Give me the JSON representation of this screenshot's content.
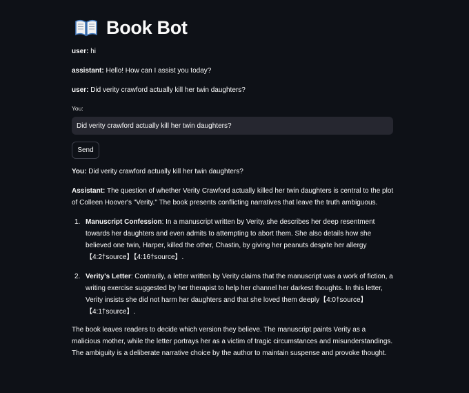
{
  "app": {
    "title": "Book Bot",
    "title_icon": "open-book-icon"
  },
  "history": [
    {
      "role": "user:",
      "text": " hi"
    },
    {
      "role": "assistant:",
      "text": " Hello! How can I assist you today?"
    },
    {
      "role": "user:",
      "text": " Did verity crawford actually kill her twin daughters?"
    }
  ],
  "input": {
    "label": "You:",
    "value": "Did verity crawford actually kill her twin daughters?"
  },
  "send_button": {
    "label": "Send"
  },
  "response": {
    "you_label": "You:",
    "you_text": " Did verity crawford actually kill her twin daughters?",
    "assistant_label": "Assistant:",
    "intro": " The question of whether Verity Crawford actually killed her twin daughters is central to the plot of Colleen Hoover's \"Verity.\" The book presents conflicting narratives that leave the truth ambiguous.",
    "items": [
      {
        "num": "1.",
        "heading": "Manuscript Confession",
        "text": ": In a manuscript written by Verity, she describes her deep resentment towards her daughters and even admits to attempting to abort them. She also details how she believed one twin, Harper, killed the other, Chastin, by giving her peanuts despite her allergy 【4:2†source】【4:16†source】."
      },
      {
        "num": "2.",
        "heading": "Verity's Letter",
        "text": ": Contrarily, a letter written by Verity claims that the manuscript was a work of fiction, a writing exercise suggested by her therapist to help her channel her darkest thoughts. In this letter, Verity insists she did not harm her daughters and that she loved them deeply【4:0†source】【4:1†source】."
      }
    ],
    "conclusion": "The book leaves readers to decide which version they believe. The manuscript paints Verity as a malicious mother, while the letter portrays her as a victim of tragic circumstances and misunderstandings. The ambiguity is a deliberate narrative choice by the author to maintain suspense and provoke thought."
  },
  "colors": {
    "background": "#0e1117",
    "text": "#fafafa",
    "input_bg": "#262730",
    "button_border": "#3d3f4a"
  }
}
